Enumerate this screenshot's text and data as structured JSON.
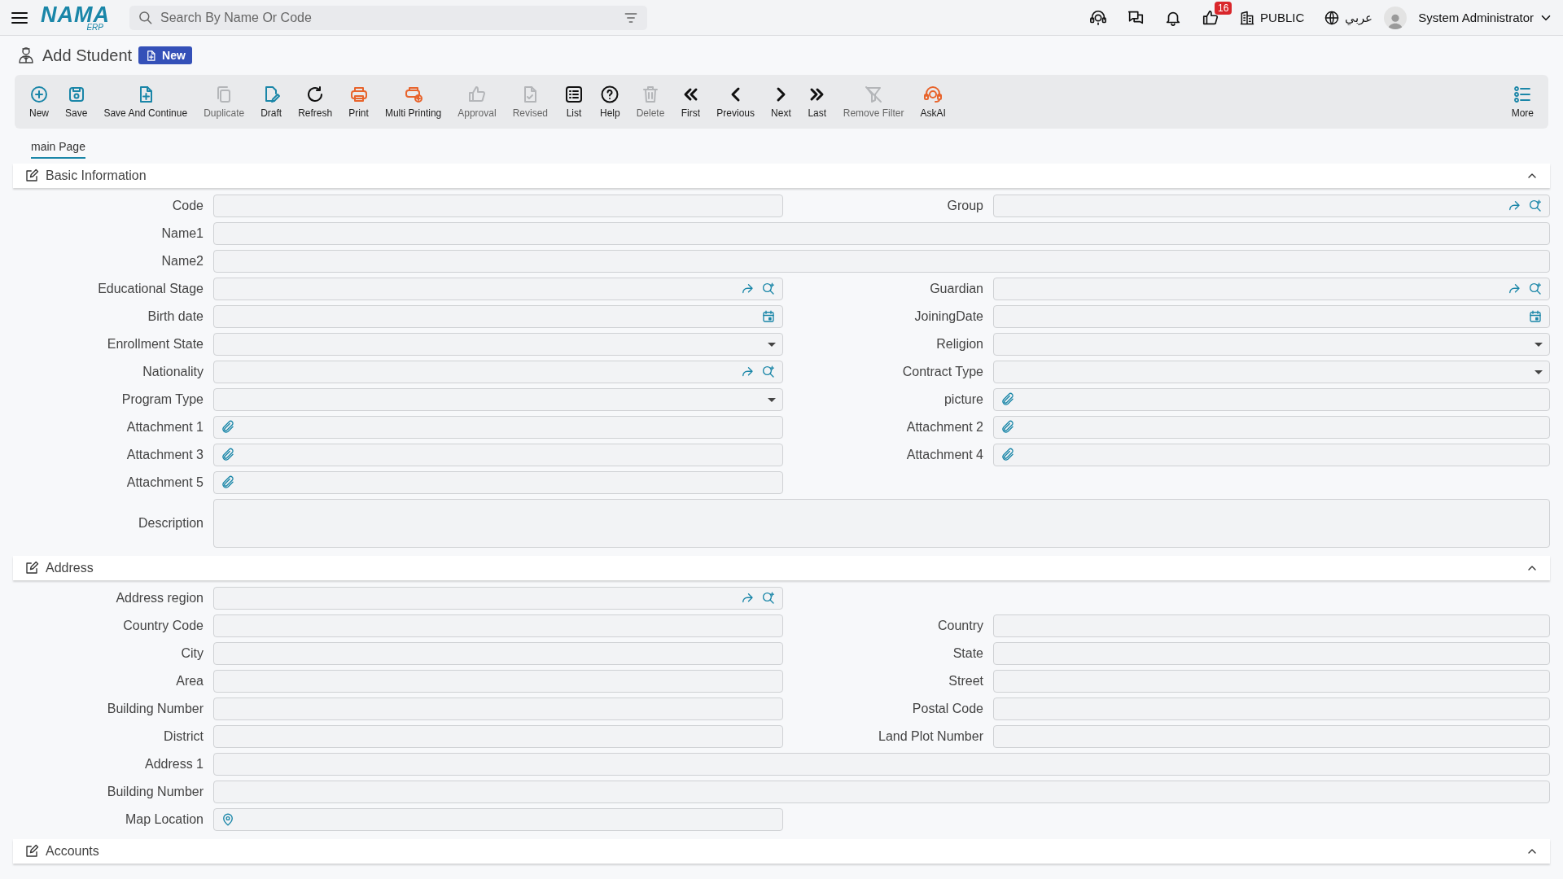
{
  "header": {
    "logo": {
      "name": "NAMA",
      "sub": "ERP"
    },
    "search": {
      "placeholder": "Search By Name Or Code"
    },
    "badge": "16",
    "branch": "PUBLIC",
    "language": "عربي",
    "user": "System Administrator"
  },
  "page": {
    "title": "Add Student",
    "status": "New"
  },
  "toolbar": [
    {
      "label": "New",
      "kind": "plus",
      "color": "#1a86a8",
      "disabled": false
    },
    {
      "label": "Save",
      "kind": "save",
      "color": "#1a86a8",
      "disabled": false
    },
    {
      "label": "Save And Continue",
      "kind": "fileplus",
      "color": "#1a86a8",
      "disabled": false
    },
    {
      "label": "Duplicate",
      "kind": "copy",
      "color": "#b4b6b9",
      "disabled": true
    },
    {
      "label": "Draft",
      "kind": "edit",
      "color": "#1a86a8",
      "disabled": false
    },
    {
      "label": "Refresh",
      "kind": "refresh",
      "color": "#111111",
      "disabled": false
    },
    {
      "label": "Print",
      "kind": "print",
      "color": "#e8642c",
      "disabled": false
    },
    {
      "label": "Multi Printing",
      "kind": "multiprint",
      "color": "#e8642c",
      "disabled": false
    },
    {
      "label": "Approval",
      "kind": "like",
      "color": "#b4b6b9",
      "disabled": true
    },
    {
      "label": "Revised",
      "kind": "filecheck",
      "color": "#b4b6b9",
      "disabled": true
    },
    {
      "label": "List",
      "kind": "list",
      "color": "#111111",
      "disabled": false
    },
    {
      "label": "Help",
      "kind": "help",
      "color": "#111111",
      "disabled": false
    },
    {
      "label": "Delete",
      "kind": "trash",
      "color": "#b4b6b9",
      "disabled": true
    },
    {
      "label": "First",
      "kind": "first",
      "color": "#111111",
      "disabled": false
    },
    {
      "label": "Previous",
      "kind": "previous",
      "color": "#111111",
      "disabled": false
    },
    {
      "label": "Next",
      "kind": "next",
      "color": "#111111",
      "disabled": false
    },
    {
      "label": "Last",
      "kind": "last",
      "color": "#111111",
      "disabled": false
    },
    {
      "label": "Remove Filter",
      "kind": "filteroff",
      "color": "#b4b6b9",
      "disabled": true
    },
    {
      "label": "AskAI",
      "kind": "ai",
      "color": "#e8642c",
      "disabled": false
    }
  ],
  "more": {
    "label": "More"
  },
  "tabs": [
    {
      "label": "main Page",
      "selected": true
    }
  ],
  "sections": [
    {
      "title": "Basic Information",
      "expanded": true,
      "rows": [
        {
          "wide": false,
          "fields": [
            {
              "label": "Code",
              "kind": "text"
            },
            {
              "label": "Group",
              "kind": "lookup"
            }
          ]
        },
        {
          "wide": true,
          "fields": [
            {
              "label": "Name1",
              "kind": "text"
            }
          ]
        },
        {
          "wide": true,
          "fields": [
            {
              "label": "Name2",
              "kind": "text"
            }
          ]
        },
        {
          "wide": false,
          "fields": [
            {
              "label": "Educational Stage",
              "kind": "lookup"
            },
            {
              "label": "Guardian",
              "kind": "lookup"
            }
          ]
        },
        {
          "wide": false,
          "fields": [
            {
              "label": "Birth date",
              "kind": "date"
            },
            {
              "label": "JoiningDate",
              "kind": "date"
            }
          ]
        },
        {
          "wide": false,
          "fields": [
            {
              "label": "Enrollment State",
              "kind": "select"
            },
            {
              "label": "Religion",
              "kind": "select"
            }
          ]
        },
        {
          "wide": false,
          "fields": [
            {
              "label": "Nationality",
              "kind": "lookup"
            },
            {
              "label": "Contract Type",
              "kind": "select"
            }
          ]
        },
        {
          "wide": false,
          "fields": [
            {
              "label": "Program Type",
              "kind": "select"
            },
            {
              "label": "picture",
              "kind": "attach"
            }
          ]
        },
        {
          "wide": false,
          "fields": [
            {
              "label": "Attachment 1",
              "kind": "attach"
            },
            {
              "label": "Attachment 2",
              "kind": "attach"
            }
          ]
        },
        {
          "wide": false,
          "fields": [
            {
              "label": "Attachment 3",
              "kind": "attach"
            },
            {
              "label": "Attachment 4",
              "kind": "attach"
            }
          ]
        },
        {
          "wide": false,
          "fields": [
            {
              "label": "Attachment 5",
              "kind": "attach"
            }
          ]
        },
        {
          "wide": true,
          "fields": [
            {
              "label": "Description",
              "kind": "textarea"
            }
          ]
        }
      ]
    },
    {
      "title": "Address",
      "expanded": true,
      "rows": [
        {
          "wide": false,
          "fields": [
            {
              "label": "Address region",
              "kind": "lookup"
            }
          ]
        },
        {
          "wide": false,
          "fields": [
            {
              "label": "Country Code",
              "kind": "text"
            },
            {
              "label": "Country",
              "kind": "text"
            }
          ]
        },
        {
          "wide": false,
          "fields": [
            {
              "label": "City",
              "kind": "text"
            },
            {
              "label": "State",
              "kind": "text"
            }
          ]
        },
        {
          "wide": false,
          "fields": [
            {
              "label": "Area",
              "kind": "text"
            },
            {
              "label": "Street",
              "kind": "text"
            }
          ]
        },
        {
          "wide": false,
          "fields": [
            {
              "label": "Building Number",
              "kind": "text"
            },
            {
              "label": "Postal Code",
              "kind": "text"
            }
          ]
        },
        {
          "wide": false,
          "fields": [
            {
              "label": "District",
              "kind": "text"
            },
            {
              "label": "Land Plot Number",
              "kind": "text"
            }
          ]
        },
        {
          "wide": true,
          "fields": [
            {
              "label": "Address 1",
              "kind": "text"
            }
          ]
        },
        {
          "wide": true,
          "fields": [
            {
              "label": "Building Number",
              "kind": "text"
            }
          ]
        },
        {
          "wide": false,
          "fields": [
            {
              "label": "Map Location",
              "kind": "map"
            }
          ]
        }
      ]
    },
    {
      "title": "Accounts",
      "expanded": true
    }
  ]
}
